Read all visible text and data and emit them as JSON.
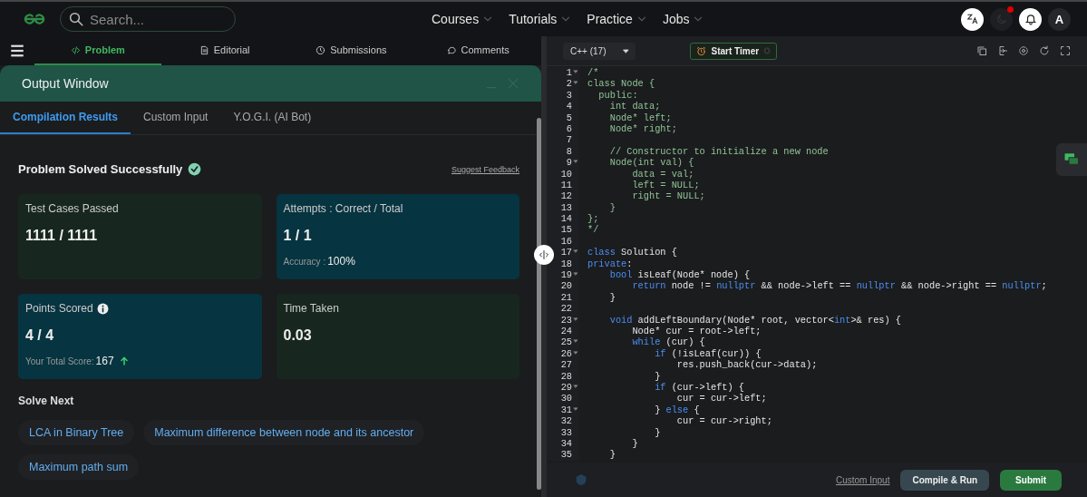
{
  "top_nav": {
    "search": {
      "placeholder": "Search..."
    },
    "menu": [
      {
        "label": "Courses"
      },
      {
        "label": "Tutorials"
      },
      {
        "label": "Practice"
      },
      {
        "label": "Jobs"
      }
    ],
    "notification_dot": true,
    "avatar": "A"
  },
  "problem_tabs": [
    {
      "label": "Problem",
      "selected": true
    },
    {
      "label": "Editorial",
      "selected": false
    },
    {
      "label": "Submissions",
      "selected": false
    },
    {
      "label": "Comments",
      "selected": false
    }
  ],
  "output_window": {
    "title": "Output Window",
    "tabs": [
      {
        "label": "Compilation Results",
        "selected": true
      },
      {
        "label": "Custom Input",
        "selected": false
      },
      {
        "label": "Y.O.G.I. (AI Bot)",
        "selected": false
      }
    ],
    "status": "Problem Solved Successfully",
    "solved": true,
    "feedback_link": "Suggest Feedback",
    "cards": [
      {
        "title": "Test Cases Passed",
        "value": "1111 / 1111",
        "color": "#17271f",
        "info": false
      },
      {
        "title": "Attempts : Correct / Total",
        "value": "1 / 1",
        "color": "#063440",
        "info": false,
        "sub_label": "Accuracy : ",
        "sub_value": "100%",
        "rising": false
      },
      {
        "title": "Points Scored",
        "value": "4 / 4",
        "color": "#063440",
        "info": true,
        "sub_label": "Your Total Score: ",
        "sub_value": "167",
        "rising": true
      },
      {
        "title": "Time Taken",
        "value": "0.03",
        "color": "#17271f",
        "info": false
      }
    ],
    "solve_next": {
      "heading": "Solve Next",
      "items": [
        "LCA in Binary Tree",
        "Maximum difference between node and its ancestor",
        "Maximum path sum"
      ]
    }
  },
  "editor": {
    "language": "C++ (17)",
    "timer_button": "Start Timer",
    "lines": [
      {
        "number": "1",
        "fold": true,
        "tokens": [
          {
            "kind": "comment",
            "text": "/*"
          }
        ]
      },
      {
        "number": "2",
        "fold": true,
        "tokens": [
          {
            "kind": "comment",
            "text": "class Node {"
          }
        ]
      },
      {
        "number": "3",
        "fold": false,
        "tokens": [
          {
            "kind": "comment",
            "text": "  public:"
          }
        ]
      },
      {
        "number": "4",
        "fold": false,
        "tokens": [
          {
            "kind": "comment",
            "text": "    int data;"
          }
        ]
      },
      {
        "number": "5",
        "fold": false,
        "tokens": [
          {
            "kind": "comment",
            "text": "    Node* left;"
          }
        ]
      },
      {
        "number": "6",
        "fold": false,
        "tokens": [
          {
            "kind": "comment",
            "text": "    Node* right;"
          }
        ]
      },
      {
        "number": "7",
        "fold": false
      },
      {
        "number": "8",
        "fold": false,
        "tokens": [
          {
            "kind": "comment",
            "text": "    // Constructor to initialize a new node"
          }
        ]
      },
      {
        "number": "9",
        "fold": true,
        "tokens": [
          {
            "kind": "comment",
            "text": "    Node(int val) {"
          }
        ]
      },
      {
        "number": "10",
        "fold": false,
        "tokens": [
          {
            "kind": "comment",
            "text": "        data = val;"
          }
        ]
      },
      {
        "number": "11",
        "fold": false,
        "tokens": [
          {
            "kind": "comment",
            "text": "        left = NULL;"
          }
        ]
      },
      {
        "number": "12",
        "fold": false,
        "tokens": [
          {
            "kind": "comment",
            "text": "        right = NULL;"
          }
        ]
      },
      {
        "number": "13",
        "fold": false,
        "tokens": [
          {
            "kind": "comment",
            "text": "    }"
          }
        ]
      },
      {
        "number": "14",
        "fold": false,
        "tokens": [
          {
            "kind": "comment",
            "text": "};"
          }
        ]
      },
      {
        "number": "15",
        "fold": false,
        "tokens": [
          {
            "kind": "comment",
            "text": "*/"
          }
        ]
      },
      {
        "number": "16",
        "fold": false
      },
      {
        "number": "17",
        "fold": true,
        "tokens": [
          {
            "kind": "keyword",
            "text": "class"
          },
          {
            "kind": "plain",
            "text": " Solution {"
          }
        ]
      },
      {
        "number": "18",
        "fold": false,
        "tokens": [
          {
            "kind": "keyword",
            "text": "private"
          },
          {
            "kind": "plain",
            "text": ":"
          }
        ]
      },
      {
        "number": "19",
        "fold": true,
        "tokens": [
          {
            "kind": "keyword",
            "text": "    bool"
          },
          {
            "kind": "plain",
            "text": " isLeaf(Node* node) {"
          }
        ]
      },
      {
        "number": "20",
        "fold": false,
        "tokens": [
          {
            "kind": "keyword",
            "text": "        return"
          },
          {
            "kind": "plain",
            "text": " node != "
          },
          {
            "kind": "keyword",
            "text": "nullptr"
          },
          {
            "kind": "plain",
            "text": " && node->left == "
          },
          {
            "kind": "keyword",
            "text": "nullptr"
          },
          {
            "kind": "plain",
            "text": " && node->right == "
          },
          {
            "kind": "keyword",
            "text": "nullptr"
          },
          {
            "kind": "plain",
            "text": ";"
          }
        ]
      },
      {
        "number": "21",
        "fold": false,
        "tokens": [
          {
            "kind": "plain",
            "text": "    }"
          }
        ]
      },
      {
        "number": "22",
        "fold": false
      },
      {
        "number": "23",
        "fold": true,
        "tokens": [
          {
            "kind": "keyword",
            "text": "    void"
          },
          {
            "kind": "plain",
            "text": " addLeftBoundary(Node* root, vector<"
          },
          {
            "kind": "keyword",
            "text": "int"
          },
          {
            "kind": "plain",
            "text": ">& res) {"
          }
        ]
      },
      {
        "number": "24",
        "fold": false,
        "tokens": [
          {
            "kind": "plain",
            "text": "        Node* cur = root->left;"
          }
        ]
      },
      {
        "number": "25",
        "fold": true,
        "tokens": [
          {
            "kind": "keyword",
            "text": "        while"
          },
          {
            "kind": "plain",
            "text": " (cur) {"
          }
        ]
      },
      {
        "number": "26",
        "fold": true,
        "tokens": [
          {
            "kind": "keyword",
            "text": "            if"
          },
          {
            "kind": "plain",
            "text": " (!isLeaf(cur)) {"
          }
        ]
      },
      {
        "number": "27",
        "fold": false,
        "tokens": [
          {
            "kind": "plain",
            "text": "                res.push_back(cur->data);"
          }
        ]
      },
      {
        "number": "28",
        "fold": false,
        "tokens": [
          {
            "kind": "plain",
            "text": "            }"
          }
        ]
      },
      {
        "number": "29",
        "fold": true,
        "tokens": [
          {
            "kind": "keyword",
            "text": "            if"
          },
          {
            "kind": "plain",
            "text": " (cur->left) {"
          }
        ]
      },
      {
        "number": "30",
        "fold": false,
        "tokens": [
          {
            "kind": "plain",
            "text": "                cur = cur->left;"
          }
        ]
      },
      {
        "number": "31",
        "fold": true,
        "tokens": [
          {
            "kind": "plain",
            "text": "            } "
          },
          {
            "kind": "keyword",
            "text": "else"
          },
          {
            "kind": "plain",
            "text": " {"
          }
        ]
      },
      {
        "number": "32",
        "fold": false,
        "tokens": [
          {
            "kind": "plain",
            "text": "                cur = cur->right;"
          }
        ]
      },
      {
        "number": "33",
        "fold": false,
        "tokens": [
          {
            "kind": "plain",
            "text": "            }"
          }
        ]
      },
      {
        "number": "34",
        "fold": false,
        "tokens": [
          {
            "kind": "plain",
            "text": "        }"
          }
        ]
      },
      {
        "number": "35",
        "fold": false,
        "tokens": [
          {
            "kind": "plain",
            "text": "    }"
          }
        ]
      }
    ],
    "footer": {
      "custom_input": "Custom Input",
      "compile_button": "Compile & Run",
      "submit_button": "Submit"
    }
  }
}
